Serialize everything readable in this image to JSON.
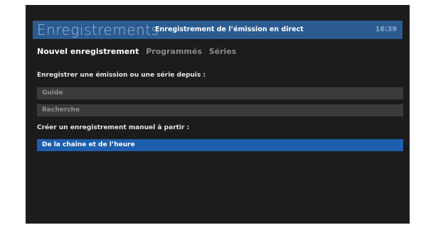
{
  "header": {
    "title": "Enregistrements",
    "subtitle": "Enregistrement de  l’émission en direct",
    "time": "16:39"
  },
  "tabs": [
    {
      "label": "Nouvel enregistrement",
      "active": true
    },
    {
      "label": "Programmés",
      "active": false
    },
    {
      "label": "Séries",
      "active": false
    }
  ],
  "sections": {
    "from_label": "Enregistrer une émission ou une série depuis :",
    "from_items": [
      "Guide",
      "Recherche"
    ],
    "manual_label": "Créer un enregistrement manuel à partir :",
    "manual_items": [
      "De la chaîne et de l’heure"
    ]
  },
  "colors": {
    "screen_background": "#1c1c1c",
    "header_bar": "#2b5b91",
    "selection": "#1e5fae",
    "row_background": "#3b3b3b"
  }
}
